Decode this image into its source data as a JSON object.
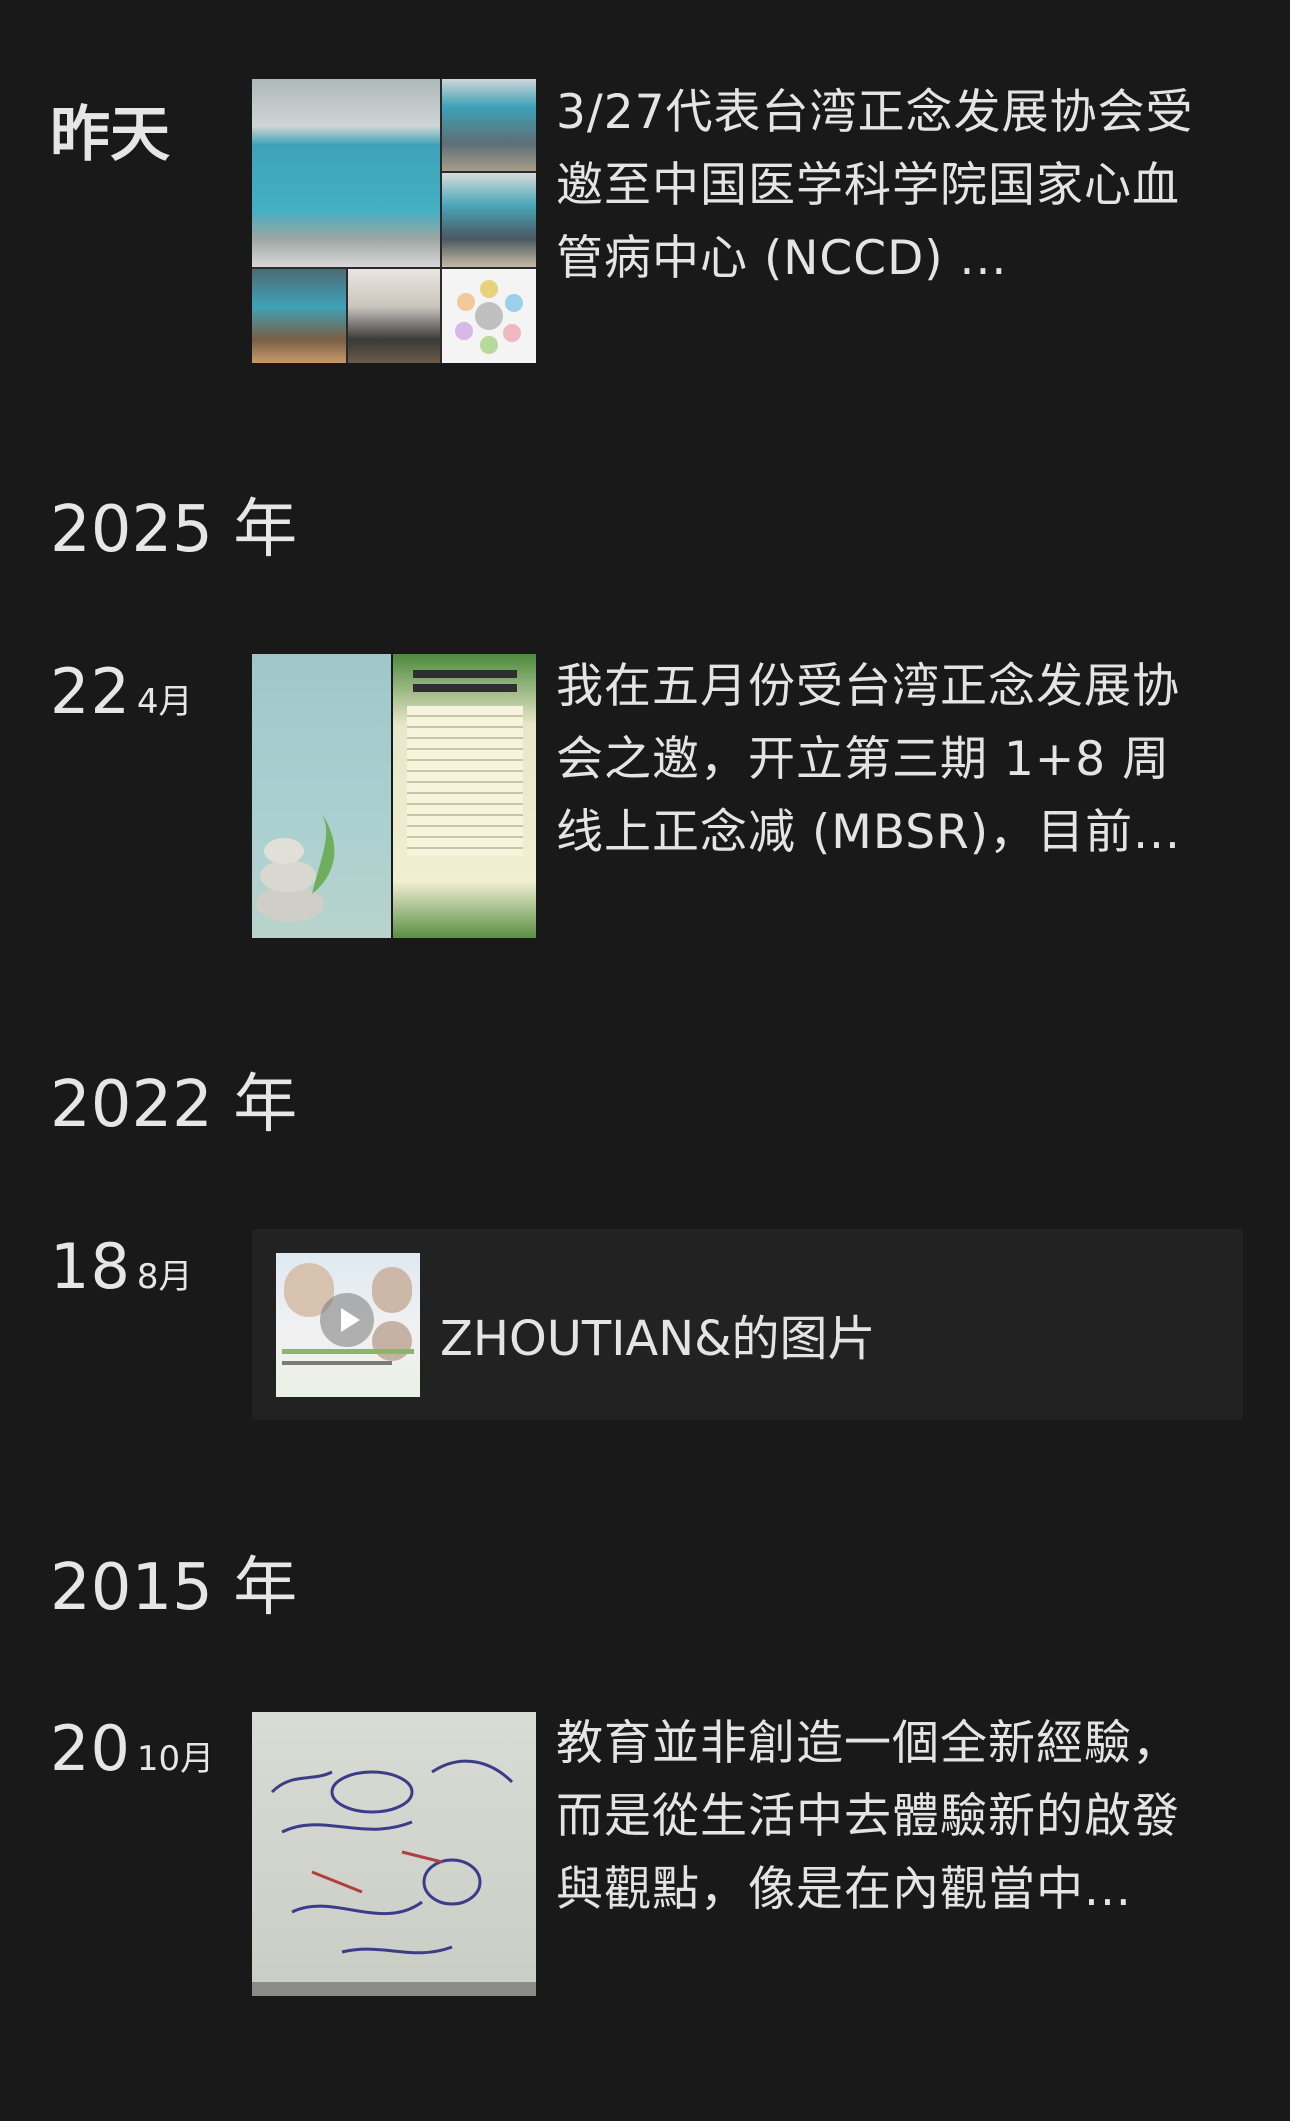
{
  "timeline": {
    "entries": [
      {
        "date_label": "昨天",
        "text": "3/27代表台湾正念发展协会受邀至中国医学科学院国家心血管病中心 (NCCD) ..."
      },
      {
        "year": "2025 年",
        "day": "22",
        "month": "4月",
        "text": "我在五月份受台湾正念发展协会之邀，开立第三期 1+8 周线上正念减 (MBSR)，目前..."
      },
      {
        "year": "2022 年",
        "day": "18",
        "month": "8月",
        "card_title": "ZHOUTIAN&的图片"
      },
      {
        "year": "2015 年",
        "day": "20",
        "month": "10月",
        "text": "教育並非創造一個全新經驗，而是從生活中去體驗新的啟發與觀點，像是在內觀當中..."
      }
    ]
  },
  "colors": {
    "background": "#191919",
    "card_background": "#222222",
    "text": "#e6e6e6"
  }
}
